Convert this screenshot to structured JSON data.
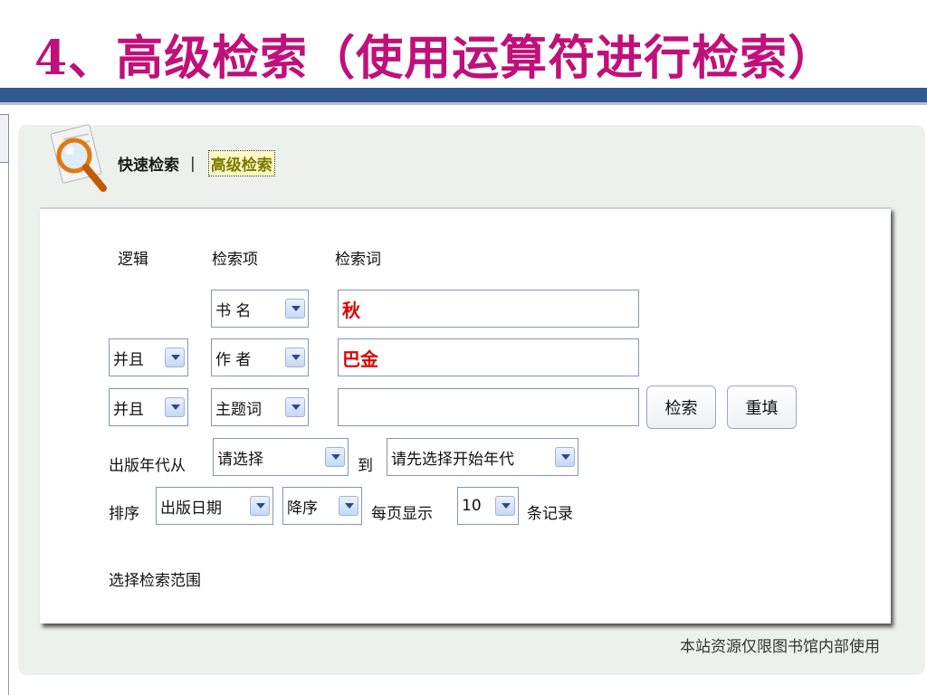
{
  "slide": {
    "title": "4、高级检索（使用运算符进行检索）"
  },
  "tabs": {
    "quick": "快速检索",
    "separator": "|",
    "advanced": "高级检索"
  },
  "headers": {
    "logic": "逻辑",
    "field": "检索项",
    "term": "检索词"
  },
  "rows": [
    {
      "logic": "",
      "field": "书 名",
      "term": "秋"
    },
    {
      "logic": "并且",
      "field": "作 者",
      "term": "巴金"
    },
    {
      "logic": "并且",
      "field": "主题词",
      "term": ""
    }
  ],
  "buttons": {
    "search": "检索",
    "reset": "重填"
  },
  "year": {
    "label": "出版年代从",
    "from": "请选择",
    "to_label": "到",
    "to": "请先选择开始年代"
  },
  "sort": {
    "label": "排序",
    "by": "出版日期",
    "order": "降序",
    "per_page_label": "每页显示",
    "per_page": "10",
    "records_label": "条记录"
  },
  "scope": {
    "label": "选择检索范围"
  },
  "footer": {
    "note": "本站资源仅限图书馆内部使用"
  },
  "colors": {
    "title": "#c0107a",
    "title_bar": "#33598f",
    "term_text": "#e00000",
    "panel_bg": "#edf1ee"
  },
  "icons": {
    "search_logo": "magnifier-icon",
    "dropdown": "chevron-down-icon"
  }
}
